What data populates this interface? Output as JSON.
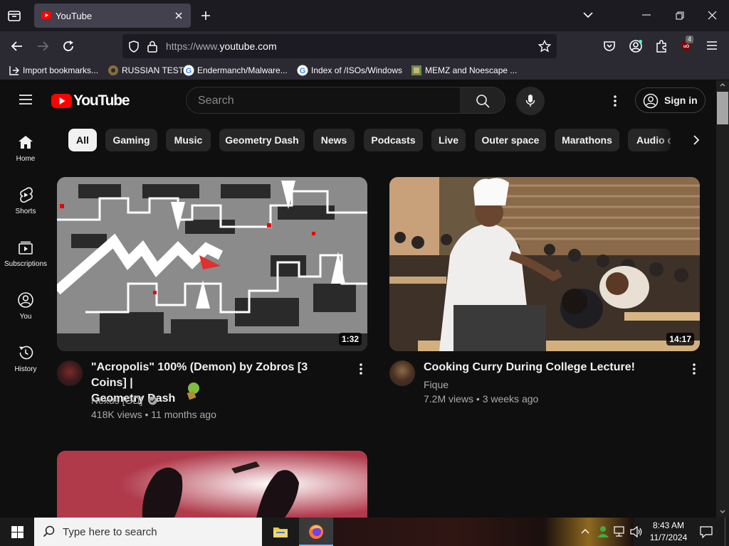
{
  "browser": {
    "tab_title": "YouTube",
    "url_prefix": "https://www.",
    "url_domain": "youtube.com",
    "extension_badge": "4",
    "bookmarks": [
      {
        "label": "Import bookmarks..."
      },
      {
        "label": "RUSSIAN TEST"
      },
      {
        "label": "Endermanch/Malware..."
      },
      {
        "label": "Index of /ISOs/Windows"
      },
      {
        "label": "MEMZ and Noescape ..."
      }
    ]
  },
  "youtube": {
    "logo_text": "YouTube",
    "search_placeholder": "Search",
    "sign_in_label": "Sign in",
    "chips": [
      {
        "label": "All",
        "active": true
      },
      {
        "label": "Gaming"
      },
      {
        "label": "Music"
      },
      {
        "label": "Geometry Dash"
      },
      {
        "label": "News"
      },
      {
        "label": "Podcasts"
      },
      {
        "label": "Live"
      },
      {
        "label": "Outer space"
      },
      {
        "label": "Marathons"
      },
      {
        "label": "Audio c"
      }
    ],
    "guide": [
      {
        "label": "Home"
      },
      {
        "label": "Shorts"
      },
      {
        "label": "Subscriptions"
      },
      {
        "label": "You"
      },
      {
        "label": "History"
      }
    ],
    "videos": [
      {
        "title_line1": "\"Acropolis\" 100% (Demon) by Zobros [3 Coins] |",
        "title_line2": "Geometry Dash",
        "channel": "Nexus [GD]",
        "meta": "418K views • 11 months ago",
        "duration": "1:32"
      },
      {
        "title_line1": "Cooking Curry During College Lecture!",
        "channel": "Fique",
        "meta": "7.2M views • 3 weeks ago",
        "duration": "14:17"
      }
    ]
  },
  "taskbar": {
    "search_text": "Type here to search",
    "time": "8:43 AM",
    "date": "11/7/2024"
  },
  "colors": {
    "youtube_red": "#ff0000",
    "page_bg": "#0f0f0f",
    "chrome_bg": "#2b2a33"
  }
}
